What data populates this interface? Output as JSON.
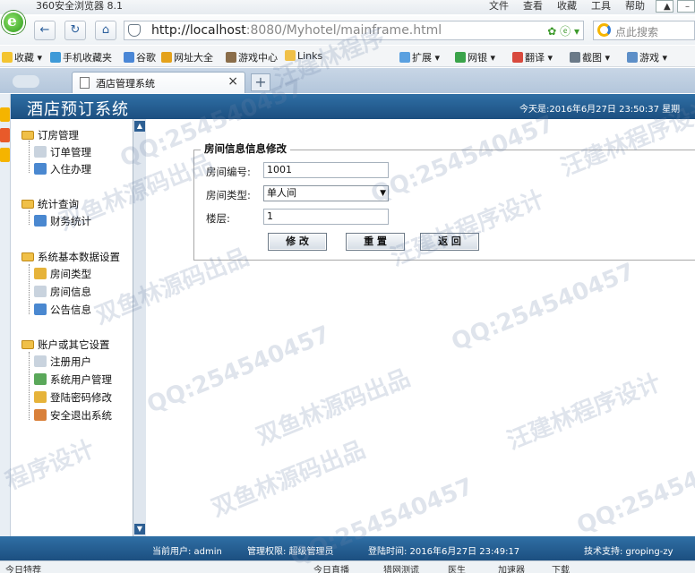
{
  "browser": {
    "window_title": "360安全浏览器 8.1",
    "menus": [
      "文件",
      "查看",
      "收藏",
      "工具",
      "帮助"
    ],
    "address_host": "http://localhost",
    "address_rest": ":8080/Myhotel/mainframe.html",
    "search_placeholder": "点此搜索",
    "favorites": [
      "收藏",
      "手机收藏夹",
      "谷歌",
      "网址大全",
      "游戏中心",
      "Links",
      "扩展",
      "网银",
      "翻译",
      "截图",
      "游戏"
    ],
    "tab_title": "酒店管理系统"
  },
  "app": {
    "brand": "酒店预订系统",
    "date_text": "今天是:2016年6月27日  23:50:37  星期"
  },
  "sidebar": {
    "groups": [
      {
        "label": "订房管理",
        "items": [
          "订单管理",
          "入住办理"
        ]
      },
      {
        "label": "统计查询",
        "items": [
          "财务统计"
        ]
      },
      {
        "label": "系统基本数据设置",
        "items": [
          "房间类型",
          "房间信息",
          "公告信息"
        ]
      },
      {
        "label": "账户或其它设置",
        "items": [
          "注册用户",
          "系统用户管理",
          "登陆密码修改",
          "安全退出系统"
        ]
      }
    ]
  },
  "form": {
    "legend": "房间信息信息修改",
    "room_number_label": "房间编号:",
    "room_number_value": "1001",
    "room_type_label": "房间类型:",
    "room_type_value": "单人间",
    "floor_label": "楼层:",
    "floor_value": "1",
    "modify_button": "修 改",
    "reset_button": "重 置",
    "back_button": "返 回"
  },
  "footer": {
    "current_user": "当前用户: admin",
    "permission": "管理权限: 超级管理员",
    "login_time": "登陆时间: 2016年6月27日 23:49:17",
    "support": "技术支持: groping-zy"
  },
  "statusbar": [
    "今日特荐",
    "今日直播",
    "猎网测谎",
    "医生",
    "加速器",
    "下载"
  ],
  "watermarks": [
    "汪建林程序",
    "QQ:254540457",
    "双鱼林源码出品",
    "QQ:254540457",
    "汪建林程序设计",
    "双鱼林源码出品",
    "QQ:254540457",
    "汪建林程序设计",
    "QQ:254540457",
    "双鱼林源码出品",
    "汪建林程序设计",
    "QQ:254540457",
    "程序设计",
    "双鱼林源码出品",
    "QQ:254540457"
  ]
}
